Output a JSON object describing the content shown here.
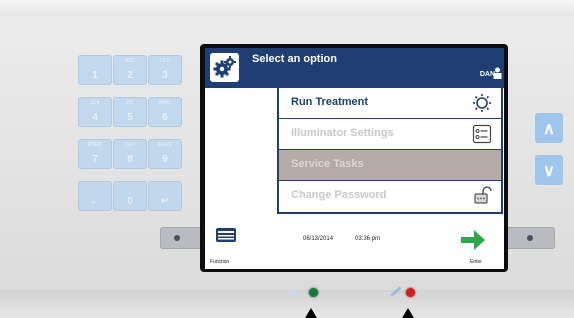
{
  "screen": {
    "title": "Select an option",
    "user": "DAN",
    "menu": {
      "items": [
        {
          "label": "Run Treatment",
          "icon": "sun-icon",
          "state": "active"
        },
        {
          "label": "Illuminator Settings",
          "icon": "settings-list-icon",
          "state": "disabled"
        },
        {
          "label": "Service Tasks",
          "icon": "",
          "state": "highlighted"
        },
        {
          "label": "Change Password",
          "icon": "lock-icon",
          "state": "disabled"
        }
      ]
    },
    "footer": {
      "function_label": "Function",
      "date": "06/13/2014",
      "time": "03:36 pm",
      "enter_label": "Enter"
    }
  },
  "keypad": {
    "keys": [
      {
        "number": "1",
        "sub": ""
      },
      {
        "number": "2",
        "sub": "ABC"
      },
      {
        "number": "3",
        "sub": "DEF"
      },
      {
        "number": "4",
        "sub": "GHI"
      },
      {
        "number": "5",
        "sub": "JKL"
      },
      {
        "number": "6",
        "sub": "MNO"
      },
      {
        "number": "7",
        "sub": "PQRS"
      },
      {
        "number": "8",
        "sub": "TUV"
      },
      {
        "number": "9",
        "sub": "WXYZ"
      },
      {
        "number": "←",
        "sub": ""
      },
      {
        "number": "0",
        "sub": ""
      },
      {
        "number": "↵",
        "sub": ""
      }
    ]
  },
  "nav": {
    "up": "∧",
    "down": "∨"
  },
  "colors": {
    "titlebar": "#1f3e73",
    "enter_arrow": "#2ea84a",
    "led_green": "#1a7a3a",
    "led_red": "#d02020",
    "keypad": "#bcd6ee"
  }
}
